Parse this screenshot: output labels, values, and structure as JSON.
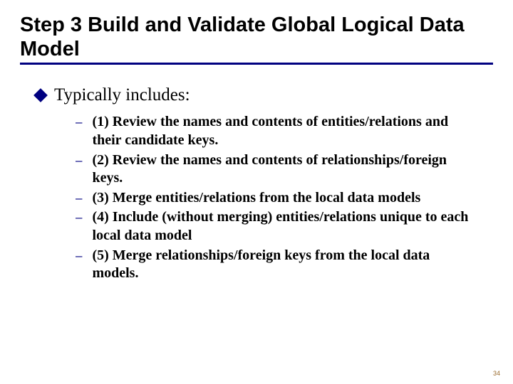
{
  "title": "Step 3  Build and Validate Global Logical Data Model",
  "main_bullet": "Typically includes:",
  "items": [
    "(1) Review the names and contents of entities/relations and their candidate keys.",
    "(2) Review the names and contents of relationships/foreign keys.",
    "(3) Merge entities/relations from the local data models",
    "(4) Include (without merging) entities/relations unique to each local data model",
    "(5) Merge relationships/foreign keys from the local data models."
  ],
  "dash": "–",
  "page_number": "34"
}
